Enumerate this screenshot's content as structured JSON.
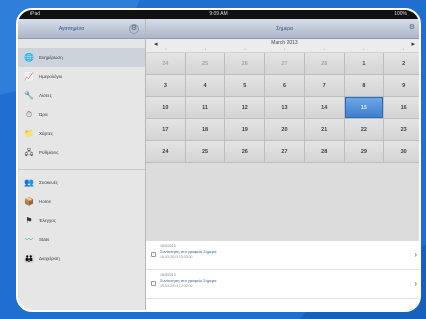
{
  "status_bar": {
    "left": "iPad",
    "center": "9:09 AM",
    "right": "100%"
  },
  "sidebar": {
    "nav_title": "Αγαπημένα",
    "group_label": "",
    "items": [
      {
        "label": "Ενημέρωση",
        "icon": "globe-icon",
        "selected": true
      },
      {
        "label": "Ημερολόγιο",
        "icon": "chart-icon",
        "selected": false
      },
      {
        "label": "Λίστες",
        "icon": "tools-icon",
        "selected": false
      },
      {
        "label": "Ώρα",
        "icon": "clock-icon",
        "selected": false
      },
      {
        "label": "Χάρτες",
        "icon": "folder-icon",
        "selected": false
      },
      {
        "label": "Ρυθμίσεις",
        "icon": "network-icon",
        "selected": false
      },
      {
        "label": "Συσκευές",
        "icon": "users-icon",
        "selected": false
      },
      {
        "label": "Home",
        "icon": "box-icon",
        "selected": false
      },
      {
        "label": "Έλεγχος",
        "icon": "flag-icon",
        "selected": false
      },
      {
        "label": "Stats",
        "icon": "graph-icon",
        "selected": false
      },
      {
        "label": "Διαχείριση",
        "icon": "people-icon",
        "selected": false
      }
    ]
  },
  "main": {
    "nav_title": "Σήμερα",
    "month_label": "March 2013",
    "dows": [
      "",
      "",
      "",
      "",
      "",
      "",
      ""
    ],
    "weeks": [
      [
        {
          "d": "24",
          "dim": true
        },
        {
          "d": "25",
          "dim": true
        },
        {
          "d": "26",
          "dim": true
        },
        {
          "d": "27",
          "dim": true
        },
        {
          "d": "28",
          "dim": true
        },
        {
          "d": "1"
        },
        {
          "d": "2"
        }
      ],
      [
        {
          "d": "3"
        },
        {
          "d": "4"
        },
        {
          "d": "5"
        },
        {
          "d": "6"
        },
        {
          "d": "7"
        },
        {
          "d": "8"
        },
        {
          "d": "9"
        }
      ],
      [
        {
          "d": "10"
        },
        {
          "d": "11"
        },
        {
          "d": "12"
        },
        {
          "d": "13"
        },
        {
          "d": "14"
        },
        {
          "d": "15",
          "today": true
        },
        {
          "d": "16"
        }
      ],
      [
        {
          "d": "17"
        },
        {
          "d": "18"
        },
        {
          "d": "19"
        },
        {
          "d": "20"
        },
        {
          "d": "21"
        },
        {
          "d": "22"
        },
        {
          "d": "23"
        }
      ],
      [
        {
          "d": "24"
        },
        {
          "d": "25"
        },
        {
          "d": "26"
        },
        {
          "d": "27"
        },
        {
          "d": "28"
        },
        {
          "d": "29"
        },
        {
          "d": "30"
        }
      ]
    ],
    "events": [
      {
        "date": "15/3/2013",
        "title": "Συνάντηση στο γραφείο Σήμερα",
        "time": "15-03-2013 10:00:00"
      },
      {
        "date": "15/3/2013",
        "title": "Συνάντηση στο γραφείο Σήμερα",
        "time": "15-03-2013 12:00:00"
      }
    ]
  },
  "colors": {
    "background": "#1e6fd0",
    "today": "#3f7fce",
    "nav": "#aab7c8"
  }
}
